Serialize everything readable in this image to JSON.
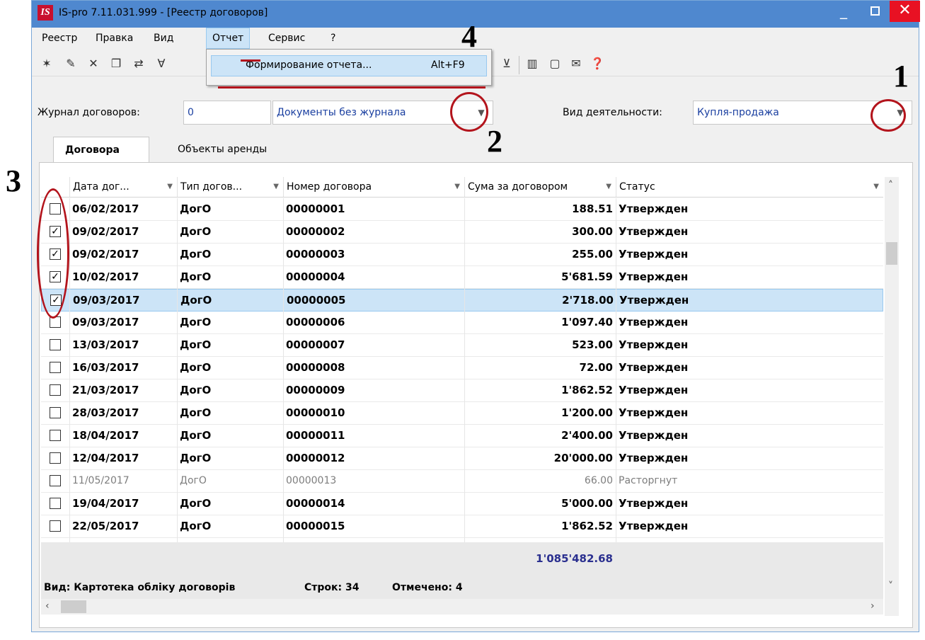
{
  "window": {
    "title": "IS-pro 7.11.031.999 - [Реестр договоров]",
    "logo": "IS"
  },
  "menu": [
    "Реестр",
    "Правка",
    "Вид",
    "Отчет",
    "Сервис",
    "?"
  ],
  "dropdown": {
    "label": "Формирование отчета...",
    "shortcut": "Alt+F9"
  },
  "filters": {
    "journal_label": "Журнал договоров:",
    "journal_code": "0",
    "journal_name": "Документы без журнала",
    "activity_label": "Вид деятельности:",
    "activity_value": "Купля-продажа"
  },
  "tabs": [
    "Договора",
    "Объекты аренды"
  ],
  "columns": [
    "Дата дог...",
    "Тип догов...",
    "Номер договора",
    "Сума за договором",
    "Статус"
  ],
  "rows": [
    {
      "checked": false,
      "date": "06/02/2017",
      "type": "ДогО",
      "number": "00000001",
      "sum": "188.51",
      "status": "Утвержден"
    },
    {
      "checked": true,
      "date": "09/02/2017",
      "type": "ДогО",
      "number": "00000002",
      "sum": "300.00",
      "status": "Утвержден"
    },
    {
      "checked": true,
      "date": "09/02/2017",
      "type": "ДогО",
      "number": "00000003",
      "sum": "255.00",
      "status": "Утвержден"
    },
    {
      "checked": true,
      "date": "10/02/2017",
      "type": "ДогО",
      "number": "00000004",
      "sum": "5'681.59",
      "status": "Утвержден"
    },
    {
      "checked": true,
      "date": "09/03/2017",
      "type": "ДогО",
      "number": "00000005",
      "sum": "2'718.00",
      "status": "Утвержден",
      "selected": true
    },
    {
      "checked": false,
      "date": "09/03/2017",
      "type": "ДогО",
      "number": "00000006",
      "sum": "1'097.40",
      "status": "Утвержден"
    },
    {
      "checked": false,
      "date": "13/03/2017",
      "type": "ДогО",
      "number": "00000007",
      "sum": "523.00",
      "status": "Утвержден"
    },
    {
      "checked": false,
      "date": "16/03/2017",
      "type": "ДогО",
      "number": "00000008",
      "sum": "72.00",
      "status": "Утвержден"
    },
    {
      "checked": false,
      "date": "21/03/2017",
      "type": "ДогО",
      "number": "00000009",
      "sum": "1'862.52",
      "status": "Утвержден"
    },
    {
      "checked": false,
      "date": "28/03/2017",
      "type": "ДогО",
      "number": "00000010",
      "sum": "1'200.00",
      "status": "Утвержден"
    },
    {
      "checked": false,
      "date": "18/04/2017",
      "type": "ДогО",
      "number": "00000011",
      "sum": "2'400.00",
      "status": "Утвержден"
    },
    {
      "checked": false,
      "date": "12/04/2017",
      "type": "ДогО",
      "number": "00000012",
      "sum": "20'000.00",
      "status": "Утвержден"
    },
    {
      "checked": false,
      "date": "11/05/2017",
      "type": "ДогО",
      "number": "00000013",
      "sum": "66.00",
      "status": "Расторгнут",
      "dim": true
    },
    {
      "checked": false,
      "date": "19/04/2017",
      "type": "ДогО",
      "number": "00000014",
      "sum": "5'000.00",
      "status": "Утвержден"
    },
    {
      "checked": false,
      "date": "22/05/2017",
      "type": "ДогО",
      "number": "00000015",
      "sum": "1'862.52",
      "status": "Утвержден"
    }
  ],
  "total": "1'085'482.68",
  "status": {
    "view": "Вид: Картотека обліку договорів",
    "rows": "Строк: 34",
    "marked": "Отмечено: 4"
  },
  "annotations": [
    "1",
    "2",
    "3",
    "4"
  ],
  "colors": {
    "titlebar": "#4f88cf",
    "close": "#e81123",
    "selection": "#cce4f7",
    "annotation": "#b3141c",
    "total_text": "#2a2f8f"
  }
}
